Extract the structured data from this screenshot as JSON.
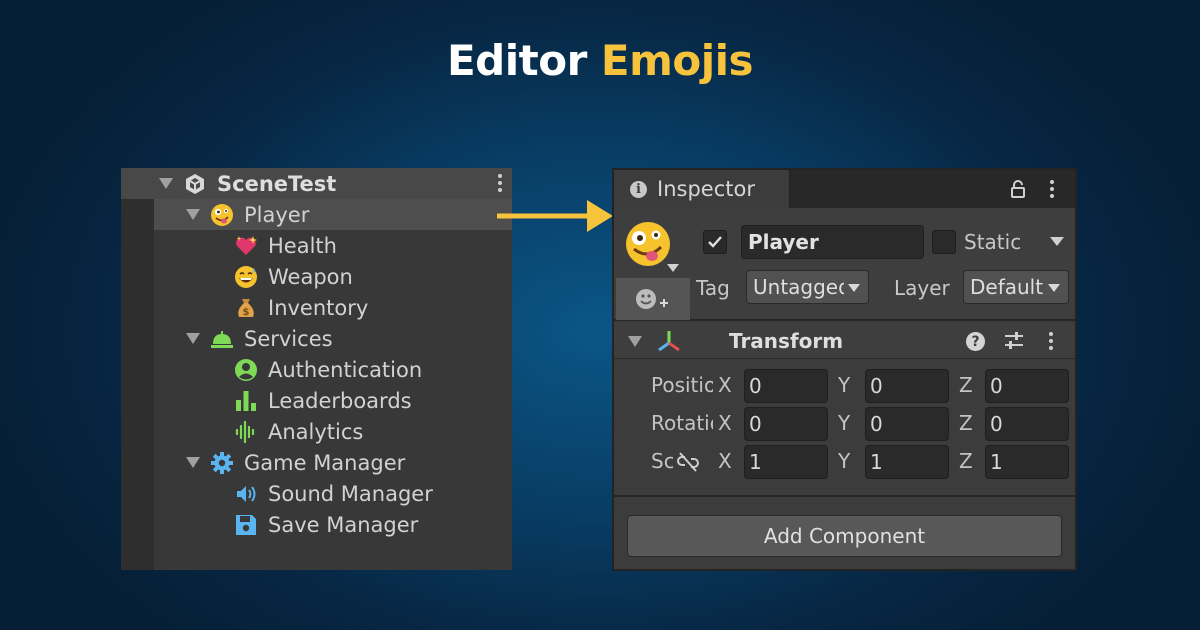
{
  "banner": {
    "title_part1": "Editor",
    "title_part2": "Emojis",
    "accent_color": "#f7c23c"
  },
  "hierarchy": {
    "scene": {
      "label": "SceneTest",
      "icon": "unity-cube-icon"
    },
    "items": [
      {
        "label": "Player",
        "icon": "zany-face-emoji",
        "expanded": true,
        "selected": true
      },
      {
        "label": "Health",
        "icon": "sparkling-heart-emoji"
      },
      {
        "label": "Weapon",
        "icon": "grinning-sweat-emoji"
      },
      {
        "label": "Inventory",
        "icon": "money-bag-emoji"
      },
      {
        "label": "Services",
        "icon": "bell-service-icon",
        "expanded": true,
        "color": "#7ed957"
      },
      {
        "label": "Authentication",
        "icon": "user-circle-icon",
        "color": "#7ed957"
      },
      {
        "label": "Leaderboards",
        "icon": "bar-chart-icon",
        "color": "#7ed957"
      },
      {
        "label": "Analytics",
        "icon": "waveform-icon",
        "color": "#7ed957"
      },
      {
        "label": "Game Manager",
        "icon": "gear-icon",
        "expanded": true,
        "color": "#5ab4f0"
      },
      {
        "label": "Sound Manager",
        "icon": "speaker-icon",
        "color": "#5ab4f0"
      },
      {
        "label": "Save Manager",
        "icon": "floppy-disk-icon",
        "color": "#5ab4f0"
      }
    ]
  },
  "inspector": {
    "tab_label": "Inspector",
    "object_name": "Player",
    "active_checked": true,
    "static_label": "Static",
    "static_checked": false,
    "tag_label": "Tag",
    "tag_value": "Untagged",
    "layer_label": "Layer",
    "layer_value": "Default",
    "transform": {
      "title": "Transform",
      "rows": [
        {
          "label": "Position",
          "x": "0",
          "y": "0",
          "z": "0"
        },
        {
          "label": "Rotation",
          "x": "0",
          "y": "0",
          "z": "0"
        },
        {
          "label": "Scale",
          "x": "1",
          "y": "1",
          "z": "1"
        }
      ],
      "axis_x": "X",
      "axis_y": "Y",
      "axis_z": "Z"
    },
    "add_component_label": "Add Component"
  }
}
